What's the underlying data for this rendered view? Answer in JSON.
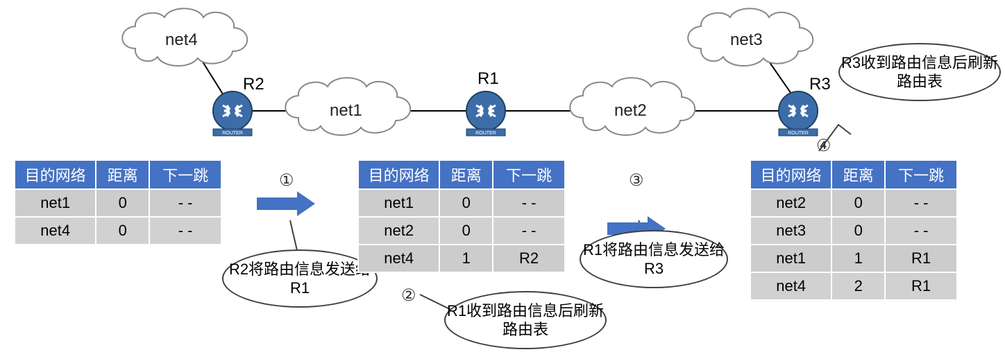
{
  "headers": {
    "dest": "目的网络",
    "dist": "距离",
    "next": "下一跳"
  },
  "r2": {
    "label": "R2",
    "rows": [
      {
        "dest": "net1",
        "dist": "0",
        "next": "- -"
      },
      {
        "dest": "net4",
        "dist": "0",
        "next": "- -"
      }
    ]
  },
  "r1": {
    "label": "R1",
    "rows": [
      {
        "dest": "net1",
        "dist": "0",
        "next": "- -"
      },
      {
        "dest": "net2",
        "dist": "0",
        "next": "- -"
      },
      {
        "dest": "net4",
        "dist": "1",
        "next": "R2"
      }
    ]
  },
  "r3": {
    "label": "R3",
    "rows": [
      {
        "dest": "net2",
        "dist": "0",
        "next": "- -"
      },
      {
        "dest": "net3",
        "dist": "0",
        "next": "- -"
      },
      {
        "dest": "net1",
        "dist": "1",
        "next": "R1"
      },
      {
        "dest": "net4",
        "dist": "2",
        "next": "R1"
      }
    ]
  },
  "nets": {
    "n1": "net1",
    "n2": "net2",
    "n3": "net3",
    "n4": "net4"
  },
  "steps": {
    "s1_num": "①",
    "s1_text": "R2将路由信息发送给R1",
    "s2_num": "②",
    "s2_text": "R1收到路由信息后刷新路由表",
    "s3_num": "③",
    "s3_text": "R1将路由信息发送给R3",
    "s4_num": "④",
    "s4_text": "R3收到路由信息后刷新路由表"
  }
}
